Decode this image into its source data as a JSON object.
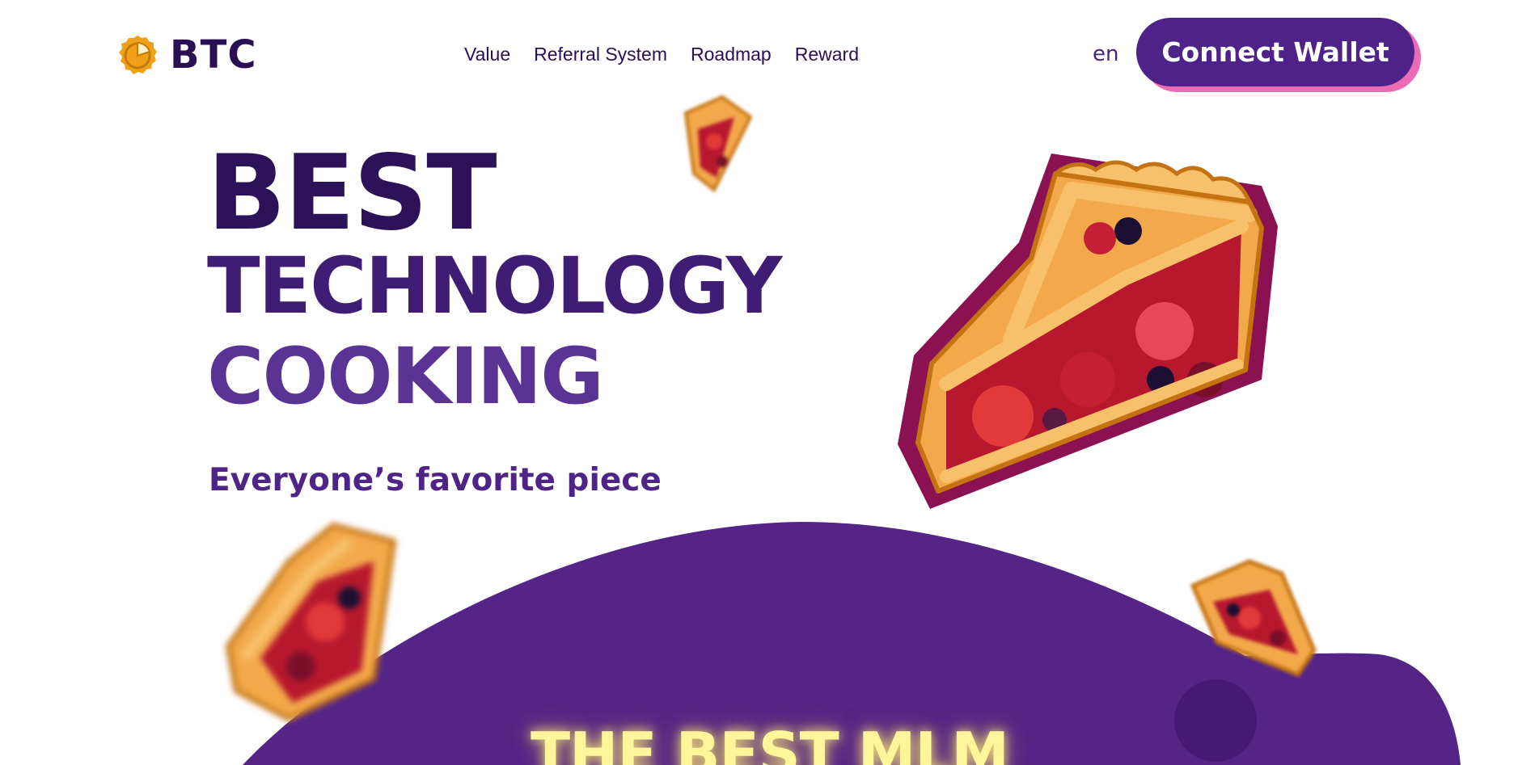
{
  "header": {
    "logo_text": "BTC",
    "nav": [
      {
        "label": "Value"
      },
      {
        "label": "Referral System"
      },
      {
        "label": "Roadmap"
      },
      {
        "label": "Reward"
      }
    ],
    "language": "en",
    "connect_button": "Connect Wallet"
  },
  "hero": {
    "title_line_1": "BEST",
    "title_line_2": "TECHNOLOGY",
    "title_line_3": "COOKING",
    "subtitle": "Everyone’s favorite piece"
  },
  "section": {
    "title": "THE BEST MLM"
  },
  "icons": {
    "logo": "pie-coin-icon",
    "decorations": [
      "pie-slice-icon"
    ]
  },
  "colors": {
    "brand_dark": "#2a1053",
    "brand_purple": "#4f2289",
    "section_bg": "#542486",
    "button_shadow": "#ec6bb6",
    "section_title": "#fff59a",
    "logo_gold": "#f0a11a"
  }
}
